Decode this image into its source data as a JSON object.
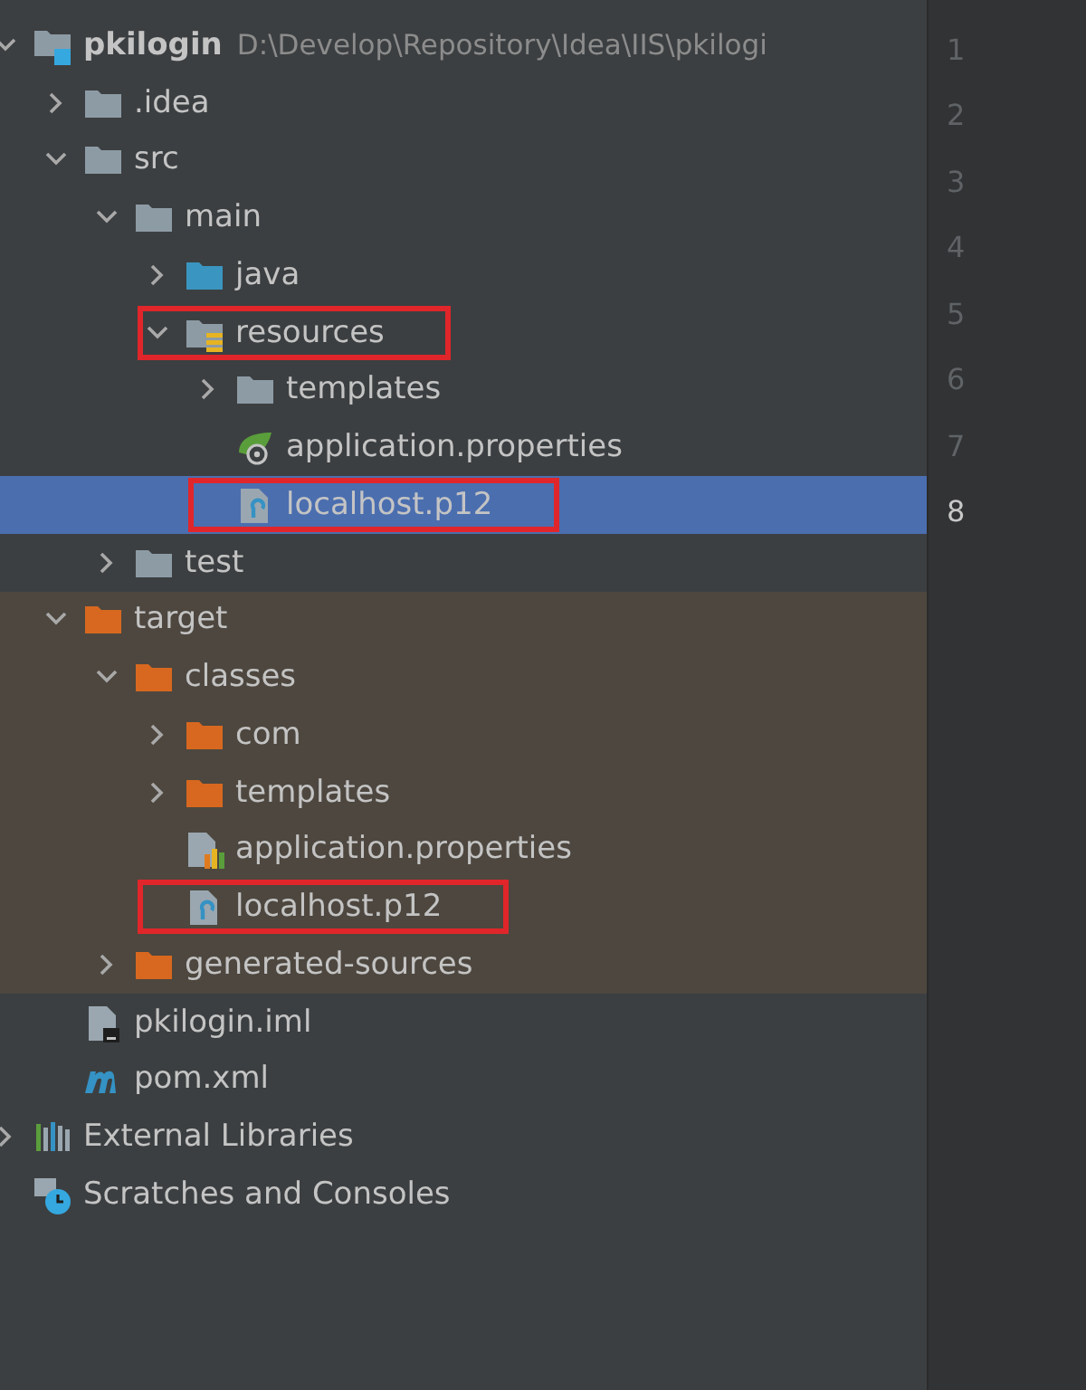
{
  "project_tree": {
    "items": [
      {
        "label": "pkilogin",
        "path": "D:\\Develop\\Repository\\Idea\\IIS\\pkilogi",
        "kind": "module",
        "expanded": true,
        "selected": false,
        "excluded": false,
        "highlighted": false,
        "children": [
          {
            "label": ".idea",
            "kind": "folder",
            "expanded": false,
            "selected": false,
            "excluded": false,
            "highlighted": false
          },
          {
            "label": "src",
            "kind": "folder",
            "expanded": true,
            "selected": false,
            "excluded": false,
            "highlighted": false,
            "children": [
              {
                "label": "main",
                "kind": "folder",
                "expanded": true,
                "selected": false,
                "excluded": false,
                "highlighted": false,
                "children": [
                  {
                    "label": "java",
                    "kind": "source-folder",
                    "expanded": false,
                    "selected": false,
                    "excluded": false,
                    "highlighted": false
                  },
                  {
                    "label": "resources",
                    "kind": "resources-folder",
                    "expanded": true,
                    "selected": false,
                    "excluded": false,
                    "highlighted": true,
                    "children": [
                      {
                        "label": "templates",
                        "kind": "folder",
                        "expanded": false,
                        "selected": false,
                        "excluded": false,
                        "highlighted": false
                      },
                      {
                        "label": "application.properties",
                        "kind": "spring-properties",
                        "selected": false,
                        "excluded": false,
                        "highlighted": false
                      },
                      {
                        "label": "localhost.p12",
                        "kind": "keystore",
                        "selected": true,
                        "excluded": false,
                        "highlighted": true
                      }
                    ]
                  }
                ]
              },
              {
                "label": "test",
                "kind": "folder",
                "expanded": false,
                "selected": false,
                "excluded": false,
                "highlighted": false
              }
            ]
          },
          {
            "label": "target",
            "kind": "excluded-folder",
            "expanded": true,
            "selected": false,
            "excluded": true,
            "highlighted": false,
            "children": [
              {
                "label": "classes",
                "kind": "excluded-folder",
                "expanded": true,
                "selected": false,
                "excluded": true,
                "highlighted": false,
                "children": [
                  {
                    "label": "com",
                    "kind": "excluded-folder",
                    "expanded": false,
                    "selected": false,
                    "excluded": true,
                    "highlighted": false
                  },
                  {
                    "label": "templates",
                    "kind": "excluded-folder",
                    "expanded": false,
                    "selected": false,
                    "excluded": true,
                    "highlighted": false
                  },
                  {
                    "label": "application.properties",
                    "kind": "properties",
                    "selected": false,
                    "excluded": true,
                    "highlighted": false
                  },
                  {
                    "label": "localhost.p12",
                    "kind": "keystore",
                    "selected": false,
                    "excluded": true,
                    "highlighted": true
                  }
                ]
              },
              {
                "label": "generated-sources",
                "kind": "excluded-folder",
                "expanded": false,
                "selected": false,
                "excluded": true,
                "highlighted": false
              }
            ]
          },
          {
            "label": "pkilogin.iml",
            "kind": "iml",
            "selected": false,
            "excluded": false,
            "highlighted": false
          },
          {
            "label": "pom.xml",
            "kind": "maven",
            "selected": false,
            "excluded": false,
            "highlighted": false
          }
        ]
      },
      {
        "label": "External Libraries",
        "kind": "libraries",
        "expanded": false,
        "selected": false,
        "excluded": false,
        "highlighted": false
      },
      {
        "label": "Scratches and Consoles",
        "kind": "scratches",
        "selected": false,
        "excluded": false,
        "highlighted": false
      }
    ]
  },
  "line_numbers": [
    {
      "text": "1",
      "current": false
    },
    {
      "text": "2",
      "current": false
    },
    {
      "text": "3",
      "current": false
    },
    {
      "text": "4",
      "current": false
    },
    {
      "text": "5",
      "current": false
    },
    {
      "text": "6",
      "current": false
    },
    {
      "text": "7",
      "current": false
    },
    {
      "text": "8",
      "current": true
    }
  ]
}
